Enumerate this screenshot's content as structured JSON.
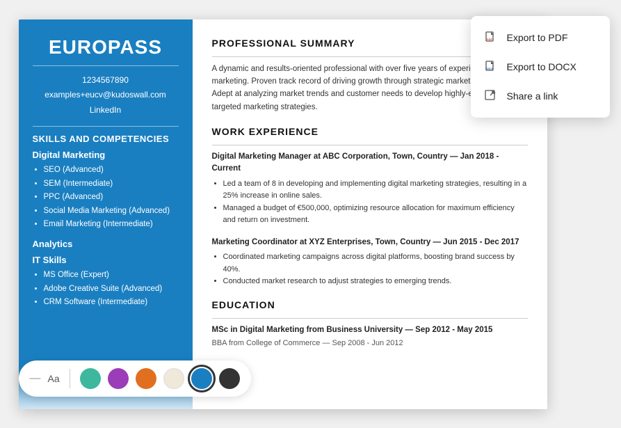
{
  "resume": {
    "name": "EUROPASS",
    "contact": {
      "phone": "1234567890",
      "email": "examples+eucv@kudoswall.com",
      "linkedin": "LinkedIn"
    },
    "sidebar_section_title": "SKILLS AND COMPETENCIES",
    "skill_groups": [
      {
        "title": "Digital Marketing",
        "skills": [
          "SEO (Advanced)",
          "SEM (Intermediate)",
          "PPC (Advanced)",
          "Social Media Marketing (Advanced)",
          "Email Marketing (Intermediate)"
        ]
      },
      {
        "title": "Analytics",
        "skills": []
      }
    ],
    "it_skills_title": "IT Skills",
    "it_skills": [
      "MS Office (Expert)",
      "Adobe Creative Suite (Advanced)",
      "CRM Software (Intermediate)"
    ]
  },
  "content": {
    "professional_summary_title": "PROFESSIONAL SUMMARY",
    "professional_summary": "A dynamic and results-oriented professional with over five years of experience in digital marketing. Proven track record of driving growth through strategic marketing campaigns. Adept at analyzing market trends and customer needs to develop highly-effective and targeted marketing strategies.",
    "work_experience_title": "WORK EXPERIENCE",
    "jobs": [
      {
        "title": "Digital Marketing Manager at ABC Corporation, Town, Country — Jan 2018 - Current",
        "bullets": [
          "Led a team of 8 in developing and implementing digital marketing strategies, resulting in a 25% increase in online sales.",
          "Managed a budget of €500,000, optimizing resource allocation for maximum efficiency and return on investment."
        ]
      },
      {
        "title": "Marketing Coordinator at XYZ Enterprises, Town, Country — Jun 2015 - Dec 2017",
        "bullets": [
          "Coordinated marketing campaigns across digital platforms, boosting brand success by 40%.",
          "Conducted market research to adjust strategies to emerging trends."
        ]
      }
    ],
    "education_title": "EDUCATION",
    "education": [
      {
        "degree": "MSc in Digital Marketing from Business University — Sep 2012 - May 2015"
      },
      {
        "degree": "BBA from College of Commerce — Sep 2008 - Jun 2012"
      }
    ]
  },
  "dropdown": {
    "items": [
      {
        "label": "Export to PDF",
        "icon": "pdf-icon"
      },
      {
        "label": "Export to DOCX",
        "icon": "docx-icon"
      },
      {
        "label": "Share a link",
        "icon": "share-icon"
      }
    ]
  },
  "toolbar": {
    "dash": "—",
    "aa": "Aa",
    "colors": [
      {
        "name": "teal",
        "hex": "#3db89e"
      },
      {
        "name": "purple",
        "hex": "#9b3db8"
      },
      {
        "name": "orange",
        "hex": "#e07020"
      },
      {
        "name": "cream",
        "hex": "#f0e8d8"
      },
      {
        "name": "blue",
        "hex": "#1a7fc1"
      },
      {
        "name": "dark",
        "hex": "#333333"
      }
    ]
  }
}
